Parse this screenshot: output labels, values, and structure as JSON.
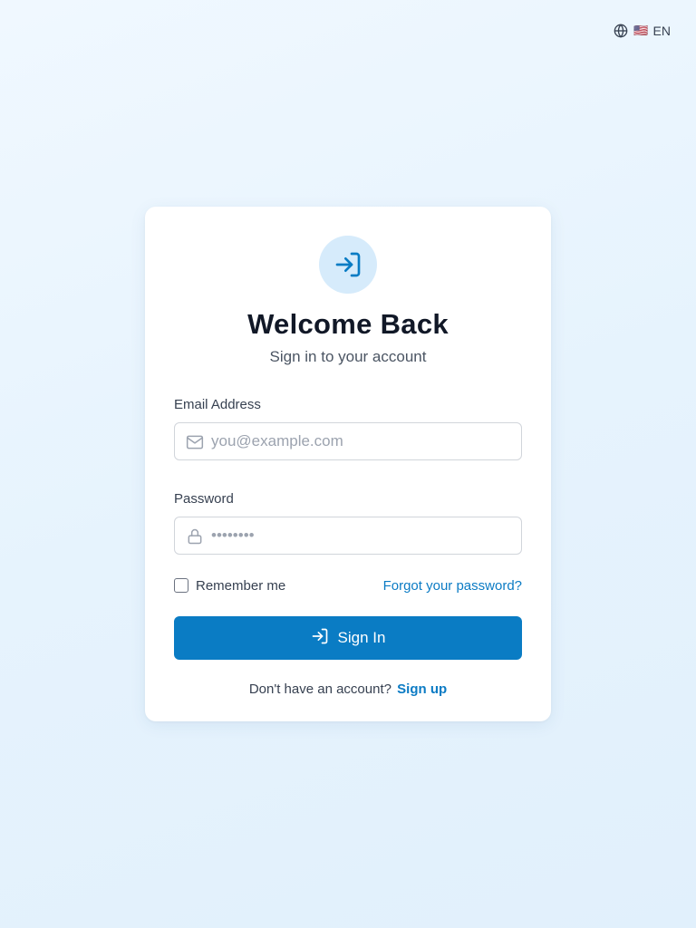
{
  "language": {
    "flag": "🇺🇸",
    "code": "EN",
    "icon": "globe-icon"
  },
  "login": {
    "hero_icon": "sign-in-icon",
    "title": "Welcome Back",
    "subtitle": "Sign in to your account",
    "email": {
      "label": "Email Address",
      "placeholder": "you@example.com",
      "value": "",
      "icon": "mail-icon"
    },
    "password": {
      "label": "Password",
      "placeholder": "••••••••",
      "value": "",
      "icon": "lock-icon"
    },
    "remember_label": "Remember me",
    "remember_checked": false,
    "forgot_label": "Forgot your password?",
    "submit_label": "Sign In",
    "submit_icon": "sign-in-icon",
    "signup_prompt": "Don't have an account?",
    "signup_label": "Sign up"
  },
  "colors": {
    "accent": "#0a7cc4",
    "link": "#0b7bc4",
    "hero_icon_bg": "#d6ebfb",
    "background": "#e6f3fd"
  }
}
